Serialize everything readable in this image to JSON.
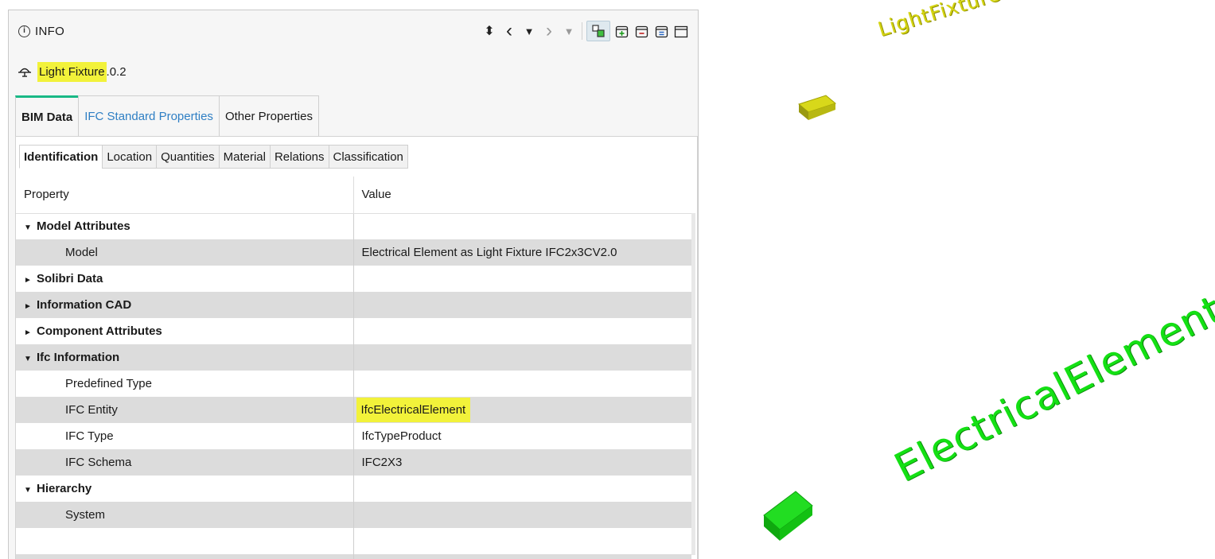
{
  "panel": {
    "title": "INFO",
    "object_name": "Light Fixture",
    "object_suffix": ".0.2"
  },
  "toolbar": {
    "buttons": [
      {
        "icon": "sort-updown-icon",
        "glyph": "⬍"
      },
      {
        "icon": "prev-icon",
        "glyph": "‹"
      },
      {
        "icon": "dropdown-icon",
        "glyph": "▼"
      },
      {
        "icon": "next-icon",
        "glyph": "›"
      },
      {
        "icon": "dropdown-disabled-icon",
        "glyph": "▼"
      },
      {
        "icon": "view-objects-icon",
        "glyph": "⚙"
      },
      {
        "icon": "expand-all-icon",
        "glyph": "⊞"
      },
      {
        "icon": "collapse-all-icon",
        "glyph": "⊟"
      },
      {
        "icon": "collapse-alt-icon",
        "glyph": "⊜"
      },
      {
        "icon": "window-icon",
        "glyph": "▭"
      }
    ]
  },
  "tabs": [
    "BIM Data",
    "IFC Standard Properties",
    "Other Properties"
  ],
  "subtabs": [
    "Identification",
    "Location",
    "Quantities",
    "Material",
    "Relations",
    "Classification"
  ],
  "table": {
    "headers": [
      "Property",
      "Value"
    ],
    "rows": [
      {
        "label": "Model Attributes",
        "value": "",
        "expander": "▼"
      },
      {
        "label": "Model",
        "value": "Electrical Element as Light Fixture IFC2x3CV2.0"
      },
      {
        "label": "Solibri Data",
        "value": "",
        "expander": "►"
      },
      {
        "label": "Information CAD",
        "value": "",
        "expander": "►"
      },
      {
        "label": "Component Attributes",
        "value": "",
        "expander": "►"
      },
      {
        "label": "Ifc Information",
        "value": "",
        "expander": "▼"
      },
      {
        "label": "Predefined Type",
        "value": ""
      },
      {
        "label": "IFC Entity",
        "value": "IfcElectricalElement"
      },
      {
        "label": "IFC Type",
        "value": "IfcTypeProduct"
      },
      {
        "label": "IFC Schema",
        "value": "IFC2X3"
      },
      {
        "label": "Hierarchy",
        "value": "",
        "expander": "▼"
      },
      {
        "label": "System",
        "value": ""
      }
    ]
  },
  "view3d": {
    "light_fixture_label": "LightFixture",
    "electrical_element_label": "ElectricalElement",
    "colors": {
      "light_fixture": "#d4d412",
      "electrical_element": "#14e014",
      "highlight": "#f2f23a",
      "tab_accent": "#19b986"
    }
  }
}
